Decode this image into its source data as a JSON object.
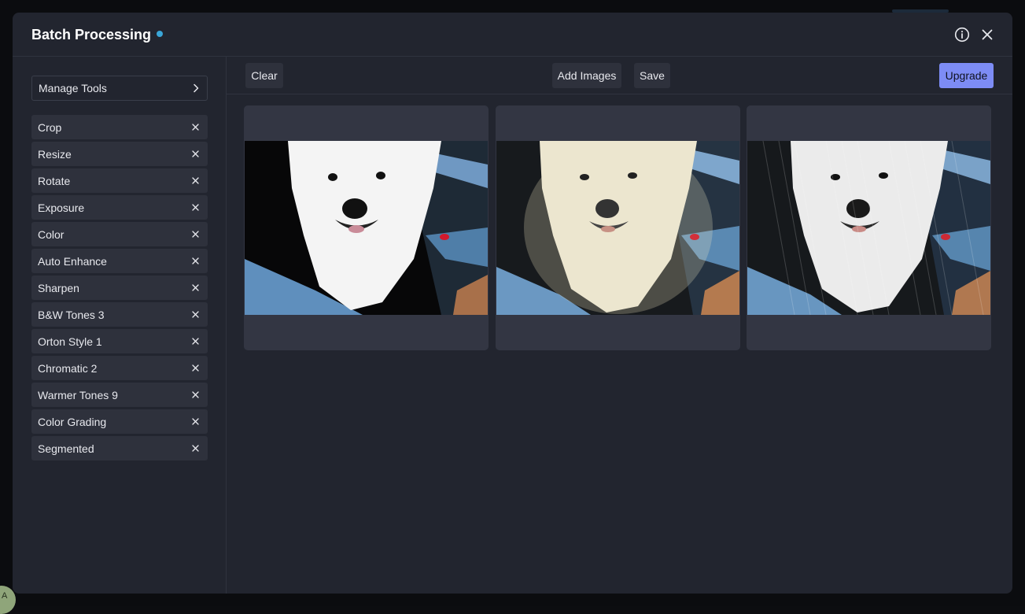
{
  "modal": {
    "title": "Batch Processing",
    "status_dot_color": "#3aa6d8"
  },
  "header_icons": {
    "info": "info-icon",
    "close": "close-icon"
  },
  "sidebar": {
    "manage_tools_label": "Manage Tools",
    "tools": [
      {
        "label": "Crop"
      },
      {
        "label": "Resize"
      },
      {
        "label": "Rotate"
      },
      {
        "label": "Exposure"
      },
      {
        "label": "Color"
      },
      {
        "label": "Auto Enhance"
      },
      {
        "label": "Sharpen"
      },
      {
        "label": "B&W Tones 3"
      },
      {
        "label": "Orton Style 1"
      },
      {
        "label": "Chromatic 2"
      },
      {
        "label": "Warmer Tones 9"
      },
      {
        "label": "Color Grading"
      },
      {
        "label": "Segmented"
      }
    ]
  },
  "toolbar": {
    "clear_label": "Clear",
    "add_images_label": "Add Images",
    "save_label": "Save",
    "upgrade_label": "Upgrade",
    "upgrade_color": "#7d8cf5"
  },
  "images": [
    {
      "subject": "samoyed-dog-photo",
      "variant": "segmented-dark-background"
    },
    {
      "subject": "samoyed-dog-photo",
      "variant": "orton-glow"
    },
    {
      "subject": "samoyed-dog-photo",
      "variant": "rain-texture"
    }
  ]
}
